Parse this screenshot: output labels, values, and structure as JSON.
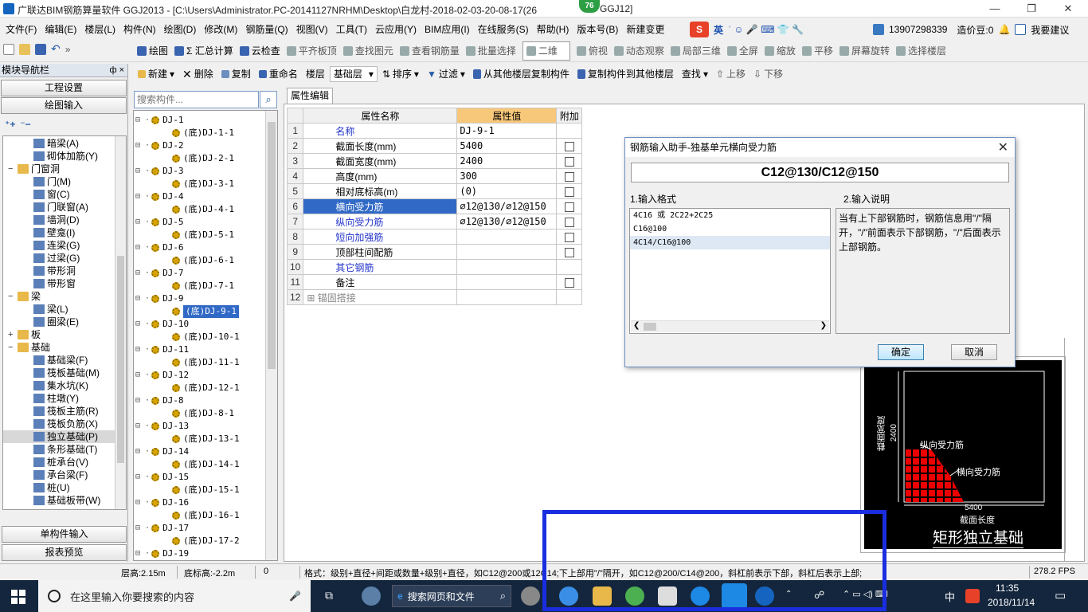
{
  "window": {
    "title": "广联达BIM钢筋算量软件 GGJ2013 - [C:\\Users\\Administrator.PC-20141127NRHM\\Desktop\\白龙村-2018-02-03-20-08-17(26",
    "title_suffix": "GGJ12]",
    "badge": "76",
    "min": "—",
    "restore": "❐",
    "close": "✕"
  },
  "menu": [
    "文件(F)",
    "编辑(E)",
    "楼层(L)",
    "构件(N)",
    "绘图(D)",
    "修改(M)",
    "钢筋量(Q)",
    "视图(V)",
    "工具(T)",
    "云应用(Y)",
    "BIM应用(I)",
    "在线服务(S)",
    "帮助(H)",
    "版本号(B)",
    "新建变更"
  ],
  "menu_right": {
    "ime": "英",
    "phone": "13907298339",
    "price": "造价豆:0",
    "suggest": "我要建议"
  },
  "toolbar1": [
    "绘图",
    "Σ 汇总计算",
    "云检查",
    "平齐板顶",
    "查找图元",
    "查看钢筋量",
    "批量选择",
    "二维",
    "俯视",
    "动态观察",
    "局部三维",
    "全屏",
    "缩放",
    "平移",
    "屏幕旋转",
    "选择楼层"
  ],
  "nav": {
    "header": "模块导航栏",
    "pin": "ф ×",
    "project": "工程设置",
    "draw": "绘图输入",
    "single": "单构件输入",
    "report": "报表预览"
  },
  "tree": [
    {
      "label": "暗梁(A)",
      "lvl": 2,
      "t": "comp"
    },
    {
      "label": "砌体加筋(Y)",
      "lvl": 2,
      "t": "comp"
    },
    {
      "label": "门窗洞",
      "lvl": 1,
      "t": "fold",
      "exp": "−"
    },
    {
      "label": "门(M)",
      "lvl": 2,
      "t": "comp"
    },
    {
      "label": "窗(C)",
      "lvl": 2,
      "t": "comp"
    },
    {
      "label": "门联窗(A)",
      "lvl": 2,
      "t": "comp"
    },
    {
      "label": "墙洞(D)",
      "lvl": 2,
      "t": "comp"
    },
    {
      "label": "壁龛(I)",
      "lvl": 2,
      "t": "comp"
    },
    {
      "label": "连梁(G)",
      "lvl": 2,
      "t": "comp"
    },
    {
      "label": "过梁(G)",
      "lvl": 2,
      "t": "comp"
    },
    {
      "label": "带形洞",
      "lvl": 2,
      "t": "comp"
    },
    {
      "label": "带形窗",
      "lvl": 2,
      "t": "comp"
    },
    {
      "label": "梁",
      "lvl": 1,
      "t": "fold",
      "exp": "−"
    },
    {
      "label": "梁(L)",
      "lvl": 2,
      "t": "comp"
    },
    {
      "label": "圈梁(E)",
      "lvl": 2,
      "t": "comp"
    },
    {
      "label": "板",
      "lvl": 1,
      "t": "fold",
      "exp": "+"
    },
    {
      "label": "基础",
      "lvl": 1,
      "t": "fold",
      "exp": "−"
    },
    {
      "label": "基础梁(F)",
      "lvl": 2,
      "t": "comp"
    },
    {
      "label": "筏板基础(M)",
      "lvl": 2,
      "t": "comp"
    },
    {
      "label": "集水坑(K)",
      "lvl": 2,
      "t": "comp"
    },
    {
      "label": "柱墩(Y)",
      "lvl": 2,
      "t": "comp"
    },
    {
      "label": "筏板主筋(R)",
      "lvl": 2,
      "t": "comp"
    },
    {
      "label": "筏板负筋(X)",
      "lvl": 2,
      "t": "comp"
    },
    {
      "label": "独立基础(P)",
      "lvl": 2,
      "t": "comp",
      "sel": true
    },
    {
      "label": "条形基础(T)",
      "lvl": 2,
      "t": "comp"
    },
    {
      "label": "桩承台(V)",
      "lvl": 2,
      "t": "comp"
    },
    {
      "label": "承台梁(F)",
      "lvl": 2,
      "t": "comp"
    },
    {
      "label": "桩(U)",
      "lvl": 2,
      "t": "comp"
    },
    {
      "label": "基础板带(W)",
      "lvl": 2,
      "t": "comp"
    }
  ],
  "midtb": {
    "new": "新建",
    "delete": "删除",
    "copy": "复制",
    "rename": "重命名",
    "floor": "楼层",
    "floor_value": "基础层",
    "sort": "排序",
    "filter": "过滤",
    "copy_from": "从其他楼层复制构件",
    "copy_to": "复制构件到其他楼层",
    "find": "查找",
    "up": "上移",
    "down": "下移"
  },
  "search_placeholder": "搜索构件...",
  "components": [
    {
      "t": "DJ-1",
      "c": "(底)DJ-1-1"
    },
    {
      "t": "DJ-2",
      "c": "(底)DJ-2-1"
    },
    {
      "t": "DJ-3",
      "c": "(底)DJ-3-1"
    },
    {
      "t": "DJ-4",
      "c": "(底)DJ-4-1"
    },
    {
      "t": "DJ-5",
      "c": "(底)DJ-5-1"
    },
    {
      "t": "DJ-6",
      "c": "(底)DJ-6-1"
    },
    {
      "t": "DJ-7",
      "c": "(底)DJ-7-1"
    },
    {
      "t": "DJ-9",
      "c": "(底)DJ-9-1",
      "sel": true
    },
    {
      "t": "DJ-10",
      "c": "(底)DJ-10-1"
    },
    {
      "t": "DJ-11",
      "c": "(底)DJ-11-1"
    },
    {
      "t": "DJ-12",
      "c": "(底)DJ-12-1"
    },
    {
      "t": "DJ-8",
      "c": "(底)DJ-8-1"
    },
    {
      "t": "DJ-13",
      "c": "(底)DJ-13-1"
    },
    {
      "t": "DJ-14",
      "c": "(底)DJ-14-1"
    },
    {
      "t": "DJ-15",
      "c": "(底)DJ-15-1"
    },
    {
      "t": "DJ-16",
      "c": "(底)DJ-16-1"
    },
    {
      "t": "DJ-17",
      "c": "(底)DJ-17-2"
    },
    {
      "t": "DJ-19",
      "c": ""
    }
  ],
  "props": {
    "tab": "属性编辑",
    "headers": [
      "属性名称",
      "属性值",
      "附加"
    ],
    "rows": [
      {
        "n": "1",
        "name": "名称",
        "val": "DJ-9-1",
        "blue": true,
        "cb": false
      },
      {
        "n": "2",
        "name": "截面长度(mm)",
        "val": "5400",
        "cb": true
      },
      {
        "n": "3",
        "name": "截面宽度(mm)",
        "val": "2400",
        "cb": true
      },
      {
        "n": "4",
        "name": "高度(mm)",
        "val": "300",
        "cb": true
      },
      {
        "n": "5",
        "name": "相对底标高(m)",
        "val": "(0)",
        "cb": true
      },
      {
        "n": "6",
        "name": "横向受力筋",
        "val": "⌀12@130/⌀12@150",
        "blue": true,
        "cb": true,
        "sel": true
      },
      {
        "n": "7",
        "name": "纵向受力筋",
        "val": "⌀12@130/⌀12@150",
        "blue": true,
        "cb": true
      },
      {
        "n": "8",
        "name": "短向加强筋",
        "val": "",
        "blue": true,
        "cb": true
      },
      {
        "n": "9",
        "name": "顶部柱间配筋",
        "val": "",
        "cb": true
      },
      {
        "n": "10",
        "name": "其它钢筋",
        "val": "",
        "blue": true,
        "cb": false
      },
      {
        "n": "11",
        "name": "备注",
        "val": "",
        "cb": true
      },
      {
        "n": "12",
        "name": "锚固搭接",
        "val": "",
        "gray": true,
        "cb": false
      }
    ]
  },
  "dialog": {
    "title": "钢筋输入助手-独基单元横向受力筋",
    "value": "C12@130/C12@150",
    "sec1": "1.输入格式",
    "sec2": "2.输入说明",
    "formats": [
      "4C16 或 2C22+2C25",
      "C16@100",
      "4C14/C16@100"
    ],
    "help": "当有上下部钢筋时，钢筋信息用\"/\"隔开，\"/\"前面表示下部钢筋，\"/\"后面表示上部钢筋。",
    "ok": "确定",
    "cancel": "取消"
  },
  "drawing": {
    "width_label": "截面宽度",
    "width_val": "2400",
    "long_bar": "纵向受力筋",
    "trans_bar": "横向受力筋",
    "len_val": "5400",
    "len_label": "截面长度",
    "caption": "矩形独立基础"
  },
  "status": {
    "floor_h": "层高:2.15m",
    "bottom": "底标高:-2.2m",
    "zero": "0",
    "hint": "格式：级别+直径+间距或数量+级别+直径，如C12@200或12C14;下上部用\"/\"隔开，如C12@200/C14@200，斜杠前表示下部，斜杠后表示上部;",
    "fps": "278.2 FPS"
  },
  "taskbar": {
    "search": "在这里输入你要搜索的内容",
    "web": "搜索网页和文件",
    "time": "11:35",
    "date": "2018/11/14",
    "lang": "中"
  }
}
